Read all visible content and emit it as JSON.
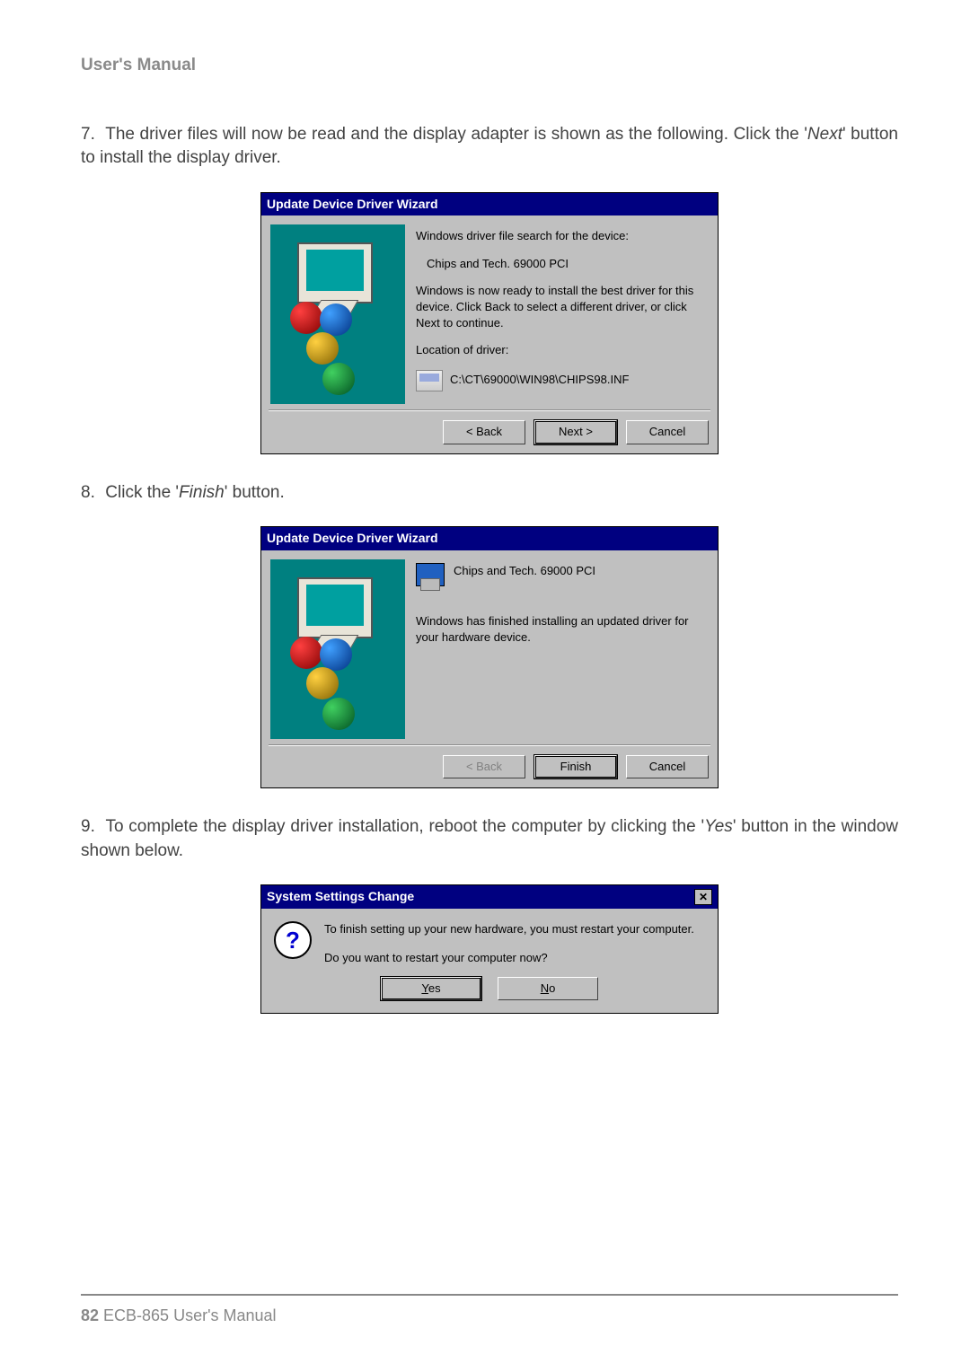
{
  "header": {
    "title": "User's Manual"
  },
  "para7": {
    "num": "7.",
    "text_a": "The driver files will now be read and the display adapter is shown as the following. Click the '",
    "text_emph": "Next",
    "text_b": "' button to install the display driver."
  },
  "dlg1": {
    "title": "Update Device Driver Wizard",
    "line1": "Windows driver file search for the device:",
    "device": "Chips and Tech. 69000 PCI",
    "line3": "Windows is now ready to install the best driver for this device. Click Back to select a different driver, or click Next to continue.",
    "loc_label": "Location of driver:",
    "loc_path": "C:\\CT\\69000\\WIN98\\CHIPS98.INF",
    "btn_back": "< Back",
    "btn_next": "Next >",
    "btn_cancel": "Cancel"
  },
  "para8": {
    "num": "8.",
    "text_a": "Click the '",
    "text_emph": "Finish",
    "text_b": "' button."
  },
  "dlg2": {
    "title": "Update Device Driver Wizard",
    "device": "Chips and Tech. 69000 PCI",
    "line2": "Windows has finished installing an updated driver for your hardware device.",
    "btn_back": "< Back",
    "btn_finish": "Finish",
    "btn_cancel": "Cancel"
  },
  "para9": {
    "num": "9.",
    "text_a": "To complete the display driver installation, reboot the computer by clicking the '",
    "text_emph": "Yes",
    "text_b": "' button in the window shown below."
  },
  "dlg3": {
    "title": "System Settings Change",
    "line1": "To finish setting up your new hardware, you must restart your computer.",
    "line2": "Do you want to restart your computer now?",
    "btn_yes": "Yes",
    "btn_no": "No"
  },
  "footer": {
    "page": "82",
    "text": " ECB-865 User's Manual"
  }
}
